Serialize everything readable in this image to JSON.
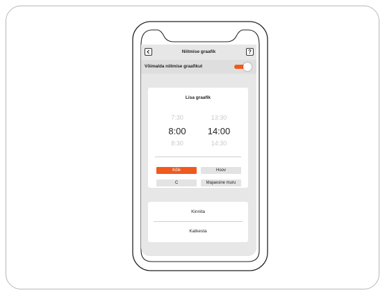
{
  "header": {
    "title": "Niitmise graafik",
    "back_icon": "chevron-left-icon",
    "help_label": "?"
  },
  "enable": {
    "label": "Võimalda niitmise graafikut",
    "on": true
  },
  "schedule": {
    "title": "Lisa graafik",
    "start_times": {
      "prev": "7:30",
      "selected": "8:00",
      "next": "8:30"
    },
    "end_times": {
      "prev": "13:30",
      "selected": "14:00",
      "next": "14:30"
    }
  },
  "zones": [
    {
      "label": "Kõik",
      "active": true
    },
    {
      "label": "Hoov",
      "active": false
    },
    {
      "label": "C",
      "active": false
    },
    {
      "label": "Majaesine muru",
      "active": false
    }
  ],
  "actions": {
    "confirm": "Kinnita",
    "cancel": "Katkesta"
  },
  "colors": {
    "accent": "#f05a1e",
    "screen_bg": "#e7e7e7"
  }
}
